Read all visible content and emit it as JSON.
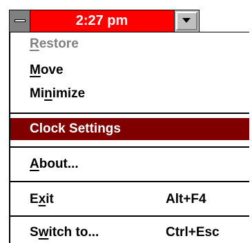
{
  "title_bar": {
    "time": "2:27 pm"
  },
  "menu": {
    "items": [
      {
        "pre": "",
        "u": "R",
        "post": "estore",
        "accel": "",
        "state": "disabled"
      },
      {
        "pre": "",
        "u": "M",
        "post": "ove",
        "accel": "",
        "state": "normal"
      },
      {
        "pre": "Mi",
        "u": "n",
        "post": "imize",
        "accel": "",
        "state": "normal"
      },
      {
        "pre": "",
        "u": "",
        "post": "Clock Settings",
        "accel": "",
        "state": "selected"
      },
      {
        "pre": "",
        "u": "A",
        "post": "bout...",
        "accel": "",
        "state": "normal"
      },
      {
        "pre": "E",
        "u": "x",
        "post": "it",
        "accel": "Alt+F4",
        "state": "normal"
      },
      {
        "pre": "S",
        "u": "w",
        "post": "itch to...",
        "accel": "Ctrl+Esc",
        "state": "normal"
      }
    ]
  },
  "colors": {
    "title_bar": "#ff0000",
    "selection": "#800000",
    "disabled_text": "#808080"
  },
  "icons": {
    "system_menu": "system-menu-icon",
    "minimize": "minimize-arrow-icon"
  }
}
